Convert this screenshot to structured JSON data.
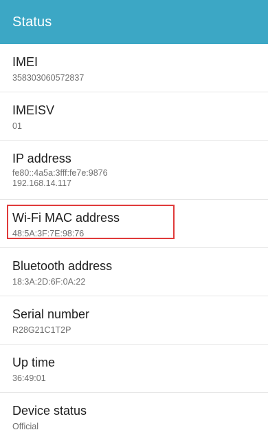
{
  "appbar": {
    "title": "Status",
    "color": "#3ca7c5"
  },
  "items": [
    {
      "label": "IMEI",
      "value": "358303060572837"
    },
    {
      "label": "IMEISV",
      "value": "01"
    },
    {
      "label": "IP address",
      "value": "fe80::4a5a:3fff:fe7e:9876",
      "value2": "192.168.14.117"
    },
    {
      "label": "Wi-Fi MAC address",
      "value": "48:5A:3F:7E:98:76"
    },
    {
      "label": "Bluetooth address",
      "value": "18:3A:2D:6F:0A:22"
    },
    {
      "label": "Serial number",
      "value": "R28G21C1T2P"
    },
    {
      "label": "Up time",
      "value": "36:49:01"
    },
    {
      "label": "Device status",
      "value": "Official"
    }
  ],
  "highlight": {
    "item": "Wi-Fi MAC address",
    "color": "#e03a3a"
  }
}
